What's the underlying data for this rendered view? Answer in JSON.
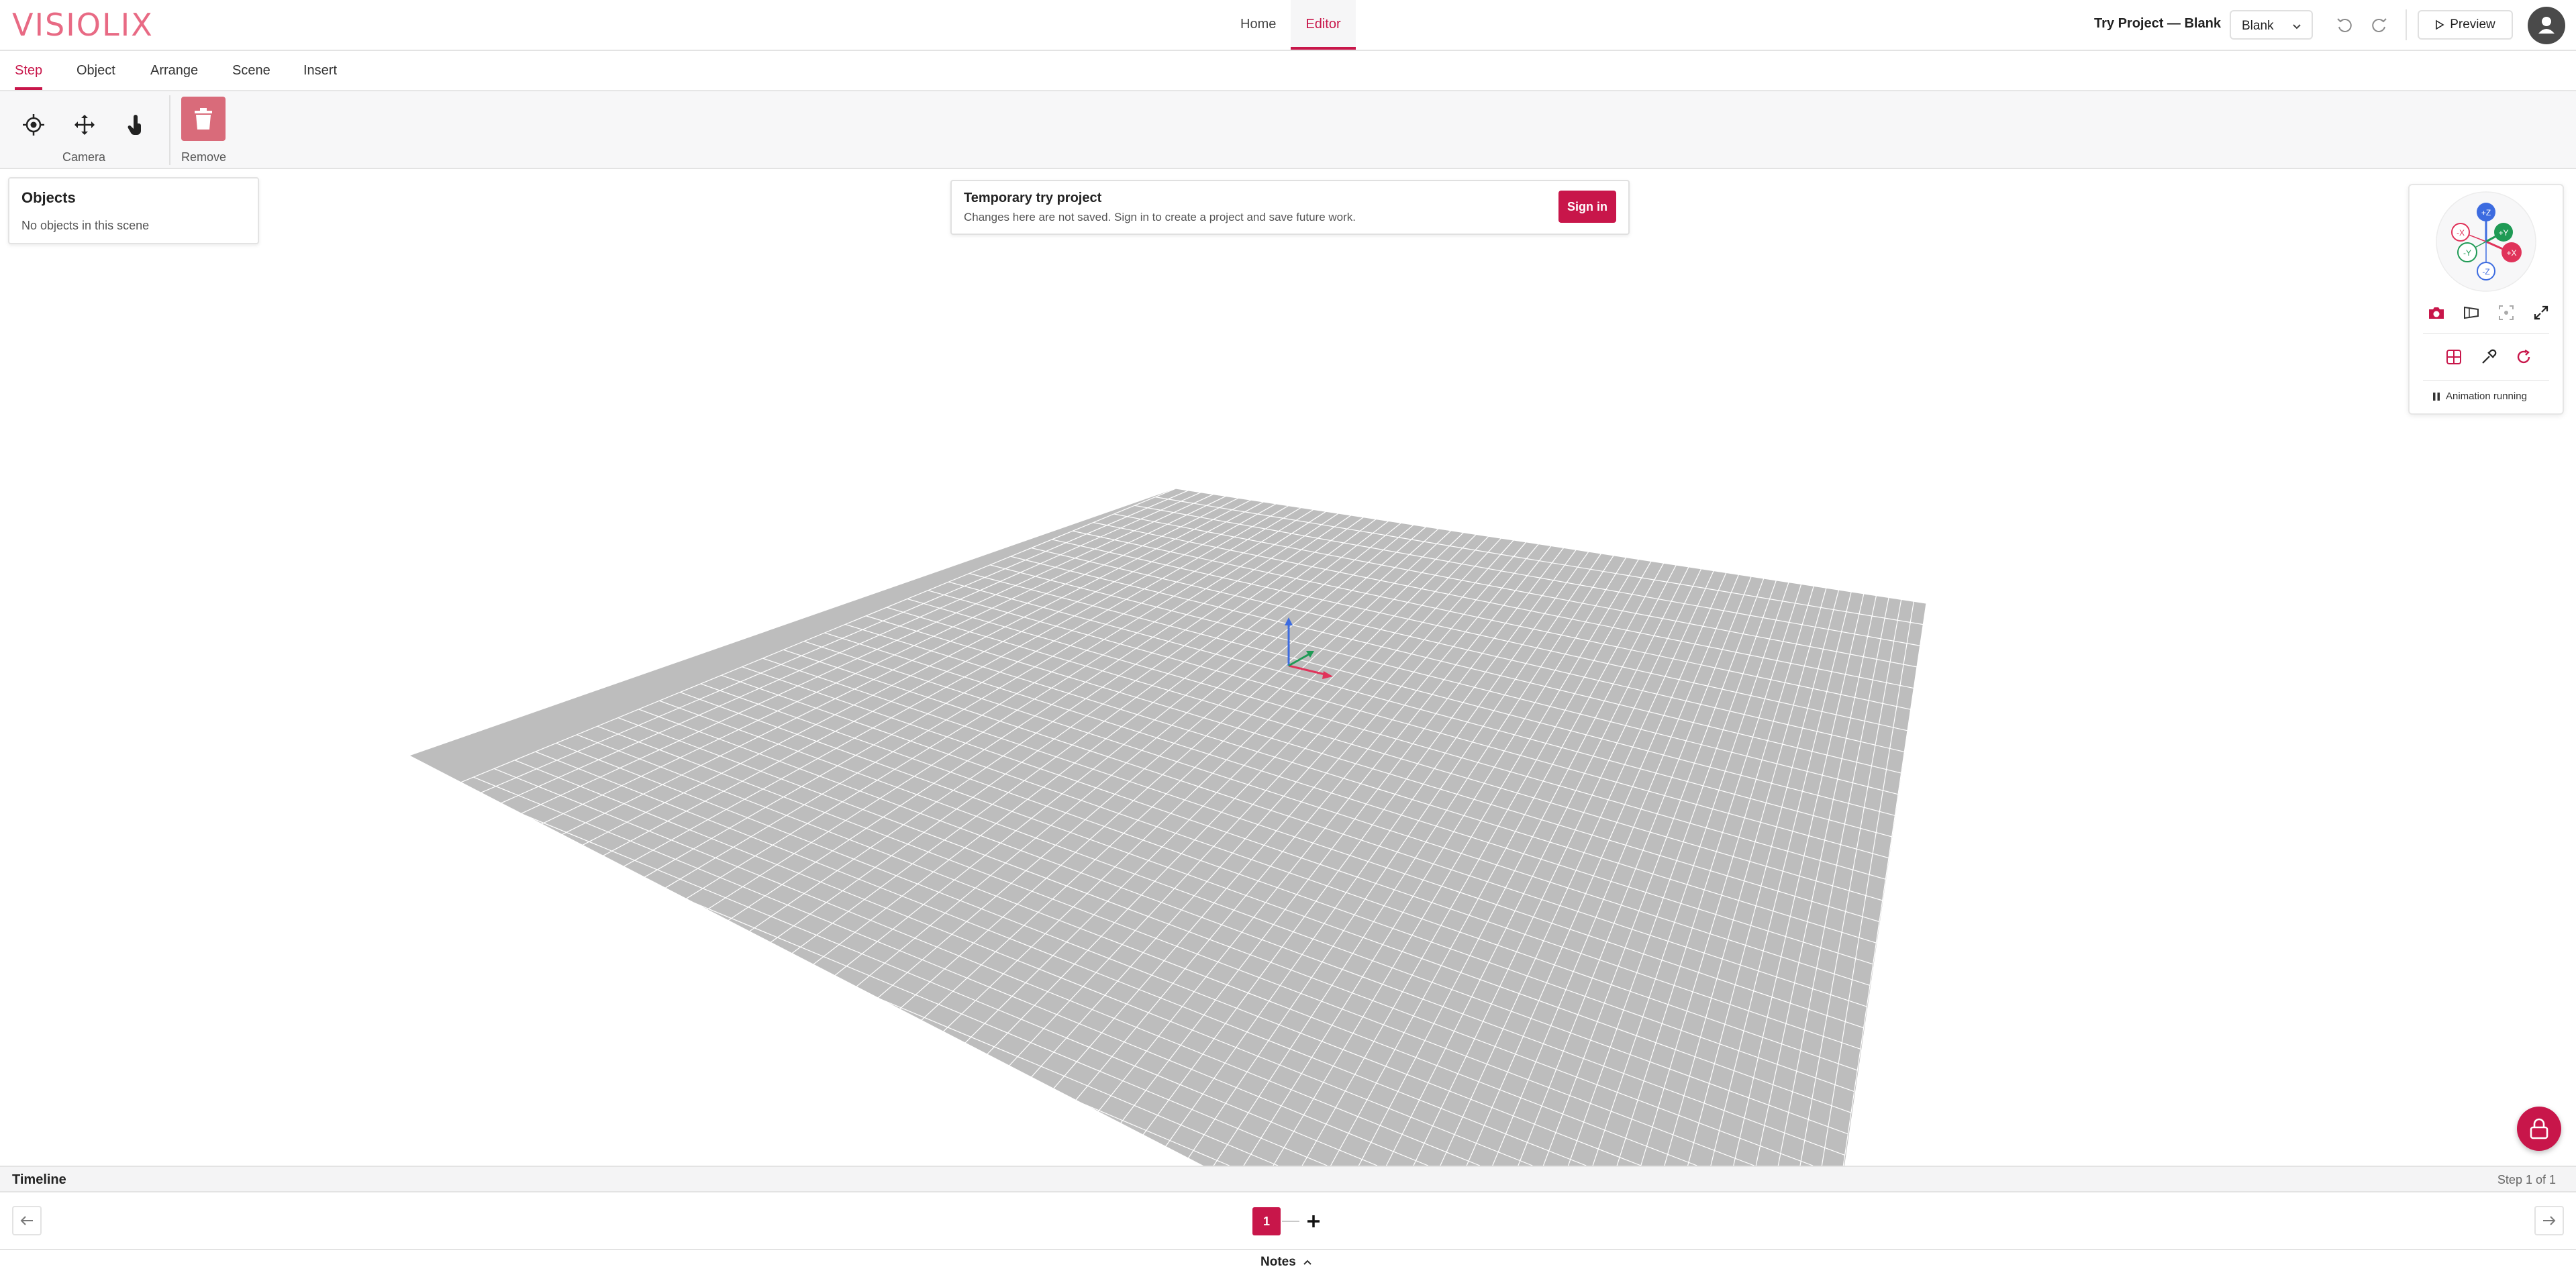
{
  "app": {
    "logo_text": "VISIOLIX"
  },
  "topnav": {
    "home": "Home",
    "editor": "Editor"
  },
  "header": {
    "project_title": "Try Project — Blank",
    "template_select": {
      "value": "Blank"
    },
    "preview_label": "Preview"
  },
  "ribbon": {
    "tabs": [
      "Step",
      "Object",
      "Arrange",
      "Scene",
      "Insert"
    ],
    "active": "Step"
  },
  "toolbar": {
    "camera_label": "Camera",
    "remove_label": "Remove",
    "camera_tools": [
      "orbit-target-icon",
      "pan-move-icon",
      "hand-pointer-icon"
    ]
  },
  "objects_panel": {
    "title": "Objects",
    "empty_text": "No objects in this scene"
  },
  "banner": {
    "title": "Temporary try project",
    "text": "Changes here are not saved. Sign in to create a project and save future work.",
    "signin_label": "Sign in"
  },
  "view_gizmo": {
    "labels": [
      "+Z",
      "+Y",
      "+X",
      "-X",
      "-Y",
      "-Z"
    ]
  },
  "view_panel": {
    "animation_status": "Animation running"
  },
  "timeline": {
    "title": "Timeline",
    "step_counter": "Step 1 of 1",
    "current_step": "1"
  },
  "notes": {
    "label": "Notes"
  },
  "colors": {
    "accent": "#c8164a",
    "logo": "#e86a84",
    "grid_fill": "#bdbdbd",
    "grid_line": "#ffffff"
  }
}
